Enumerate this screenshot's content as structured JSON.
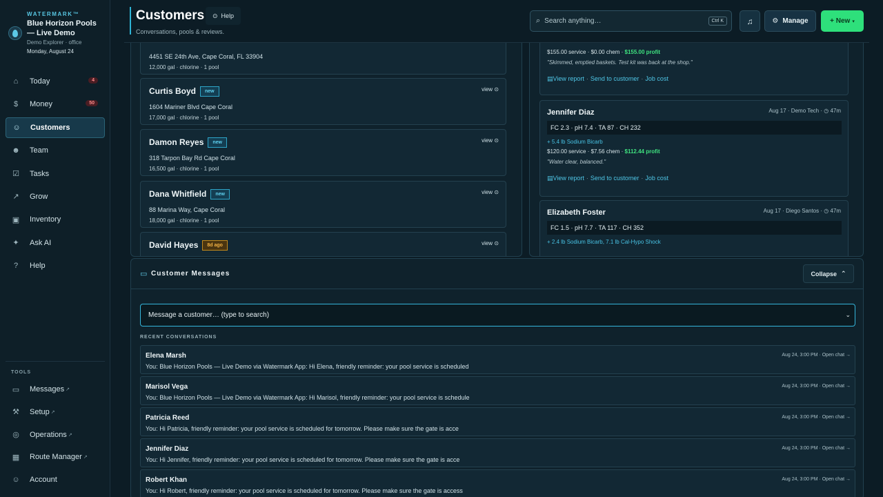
{
  "brand": {
    "watermark": "WATERMARK™",
    "name": "Blue Horizon Pools — Live Demo",
    "subtitle": "Demo Explorer · office",
    "date": "Monday, August 24"
  },
  "nav": [
    {
      "label": "Today",
      "icon": "home-icon",
      "badge": "4"
    },
    {
      "label": "Money",
      "icon": "dollar-icon",
      "badge": "50"
    },
    {
      "label": "Customers",
      "icon": "users-icon",
      "badge": ""
    },
    {
      "label": "Team",
      "icon": "team-icon",
      "badge": ""
    },
    {
      "label": "Tasks",
      "icon": "checkbox-icon",
      "badge": ""
    },
    {
      "label": "Grow",
      "icon": "trend-icon",
      "badge": ""
    },
    {
      "label": "Inventory",
      "icon": "box-icon",
      "badge": ""
    },
    {
      "label": "Ask AI",
      "icon": "sparkle-icon",
      "badge": ""
    },
    {
      "label": "Help",
      "icon": "help-icon",
      "badge": ""
    }
  ],
  "tools": {
    "label": "TOOLS",
    "items": [
      {
        "label": "Messages"
      },
      {
        "label": "Setup"
      },
      {
        "label": "Operations"
      },
      {
        "label": "Route Manager"
      },
      {
        "label": "Account"
      }
    ]
  },
  "header": {
    "title": "Customers",
    "subtitle": "Conversations, pools & reviews.",
    "help_label": "Help",
    "search_placeholder": "Search anything…",
    "search_shortcut": "Ctrl K",
    "manage_label": "Manage",
    "new_label": "+ New"
  },
  "customers": [
    {
      "name": "",
      "tag": "",
      "addr": "4451 SE 24th Ave, Cape Coral, FL 33904",
      "meta": "12,000 gal · chlorine · 1 pool",
      "view": ""
    },
    {
      "name": "Curtis Boyd",
      "tag": "new",
      "addr": "1604 Mariner Blvd Cape Coral",
      "meta": "17,000 gal · chlorine · 1 pool",
      "view": "view ⊙"
    },
    {
      "name": "Damon Reyes",
      "tag": "new",
      "addr": "318 Tarpon Bay Rd Cape Coral",
      "meta": "16,500 gal · chlorine · 1 pool",
      "view": "view ⊙"
    },
    {
      "name": "Dana Whitfield",
      "tag": "new",
      "addr": "88 Marina Way, Cape Coral",
      "meta": "18,000 gal · chlorine · 1 pool",
      "view": "view ⊙"
    },
    {
      "name": "David Hayes",
      "tag": "8d ago",
      "addr": "",
      "meta": "",
      "view": "view ⊙"
    }
  ],
  "visits": [
    {
      "name": "",
      "meta": "",
      "readings": "",
      "chem": "",
      "service": "$155.00 service · $0.00 chem · ",
      "profit": "$155.00 profit",
      "note": "\"Skimmed, emptied baskets. Test kit was back at the shop.\"",
      "link_report": "View report",
      "link_send": "Send to customer",
      "link_cost": "Job cost"
    },
    {
      "name": "Jennifer Diaz",
      "meta": "Aug 17 · Demo Tech · ◷ 47m",
      "readings": "FC 2.3 · pH 7.4 · TA 87 · CH 232",
      "chem": "+ 5.4 lb Sodium Bicarb",
      "service": "$120.00 service · $7.56 chem · ",
      "profit": "$112.44 profit",
      "note": "\"Water clear, balanced.\"",
      "link_report": "View report",
      "link_send": "Send to customer",
      "link_cost": "Job cost"
    },
    {
      "name": "Elizabeth Foster",
      "meta": "Aug 17 · Diego Santos · ◷ 47m",
      "readings": "FC 1.5 · pH 7.7 · TA 117 · CH 352",
      "chem": "+ 2.4 lb Sodium Bicarb, 7.1 lb Cal-Hypo Shock",
      "service": "",
      "profit": "",
      "note": "",
      "link_report": "",
      "link_send": "",
      "link_cost": ""
    }
  ],
  "messages": {
    "title": "Customer Messages",
    "collapse_label": "Collapse",
    "select_placeholder": "Message a customer… (type to search)",
    "recent_label": "RECENT CONVERSATIONS",
    "conversations": [
      {
        "name": "Elena Marsh",
        "text": "You: Blue Horizon Pools — Live Demo via Watermark App: Hi Elena, friendly reminder: your pool service is scheduled",
        "meta": "Aug 24, 3:00 PM · Open chat →"
      },
      {
        "name": "Marisol Vega",
        "text": "You: Blue Horizon Pools — Live Demo via Watermark App: Hi Marisol, friendly reminder: your pool service is schedule",
        "meta": "Aug 24, 3:00 PM · Open chat →"
      },
      {
        "name": "Patricia Reed",
        "text": "You: Hi Patricia, friendly reminder: your pool service is scheduled for tomorrow. Please make sure the gate is acce",
        "meta": "Aug 24, 3:00 PM · Open chat →"
      },
      {
        "name": "Jennifer Diaz",
        "text": "You: Hi Jennifer, friendly reminder: your pool service is scheduled for tomorrow. Please make sure the gate is acce",
        "meta": "Aug 24, 3:00 PM · Open chat →"
      },
      {
        "name": "Robert Khan",
        "text": "You: Hi Robert, friendly reminder: your pool service is scheduled for tomorrow. Please make sure the gate is access",
        "meta": "Aug 24, 3:00 PM · Open chat →"
      }
    ]
  }
}
